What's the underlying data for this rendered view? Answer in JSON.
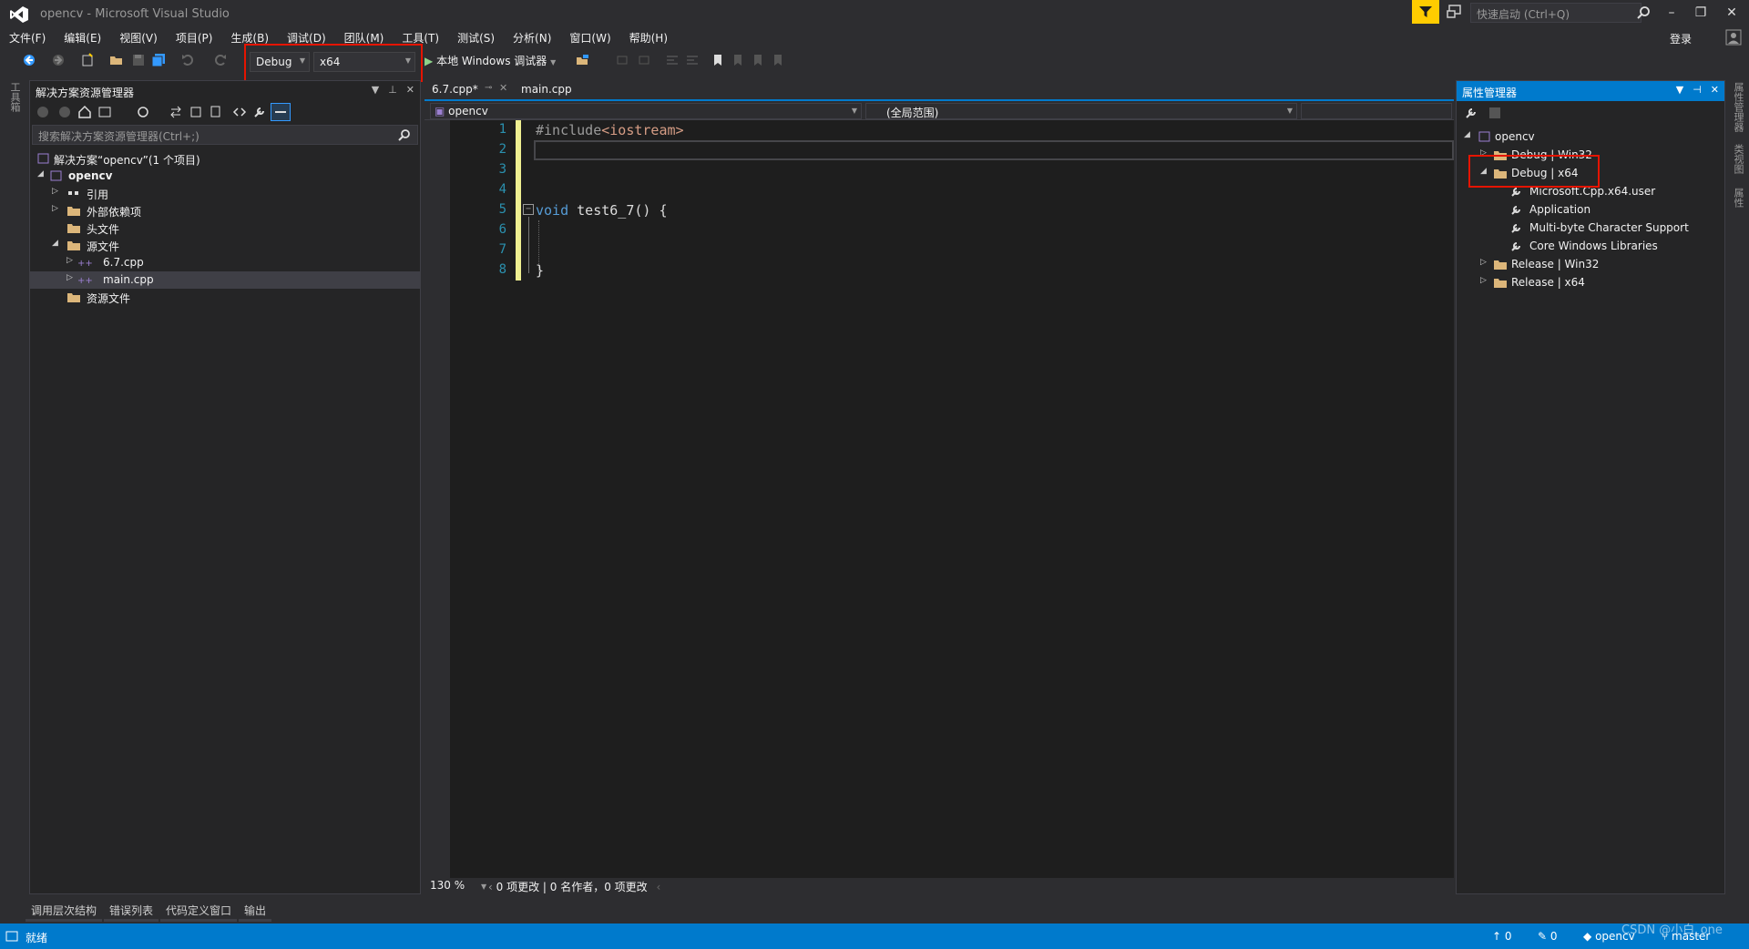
{
  "window": {
    "title": "opencv - Microsoft Visual Studio",
    "quick_launch_placeholder": "快速启动 (Ctrl+Q)",
    "login": "登录",
    "controls": [
      "–",
      "❐",
      "✕"
    ]
  },
  "menu": [
    "文件(F)",
    "编辑(E)",
    "视图(V)",
    "项目(P)",
    "生成(B)",
    "调试(D)",
    "团队(M)",
    "工具(T)",
    "测试(S)",
    "分析(N)",
    "窗口(W)",
    "帮助(H)"
  ],
  "toolbar": {
    "config": "Debug",
    "platform": "x64",
    "run_label": "本地 Windows 调试器"
  },
  "left_strip": {
    "tab": "工具箱"
  },
  "solution_explorer": {
    "title": "解决方案资源管理器",
    "search_placeholder": "搜索解决方案资源管理器(Ctrl+;)",
    "tree": [
      {
        "label": "解决方案“opencv”(1 个项目)"
      },
      {
        "label": "opencv"
      },
      {
        "label": "引用"
      },
      {
        "label": "外部依赖项"
      },
      {
        "label": "头文件"
      },
      {
        "label": "源文件"
      },
      {
        "label": "6.7.cpp"
      },
      {
        "label": "main.cpp"
      },
      {
        "label": "资源文件"
      }
    ]
  },
  "bottom_tabs": [
    "调用层次结构",
    "错误列表",
    "代码定义窗口",
    "输出"
  ],
  "editor": {
    "tabs": [
      {
        "label": "6.7.cpp*"
      },
      {
        "label": "main.cpp"
      }
    ],
    "nav_project": "opencv",
    "nav_scope": "(全局范围)",
    "line_numbers": [
      "1",
      "2",
      "3",
      "4",
      "5",
      "6",
      "7",
      "8"
    ],
    "lines": {
      "l1_kw": "#include",
      "l1_inc": "<iostream>",
      "l5_kw": "void",
      "l5_rest": " test6_7() {",
      "l8": "}"
    },
    "zoom": "130 %",
    "codelens": "0 项更改 | 0 名作者，0 项更改"
  },
  "property_manager": {
    "title": "属性管理器",
    "tree": [
      {
        "label": "opencv"
      },
      {
        "label": "Debug | Win32"
      },
      {
        "label": "Debug | x64"
      },
      {
        "label": "Microsoft.Cpp.x64.user"
      },
      {
        "label": "Application"
      },
      {
        "label": "Multi-byte Character Support"
      },
      {
        "label": "Core Windows Libraries"
      },
      {
        "label": "Release | Win32"
      },
      {
        "label": "Release | x64"
      }
    ]
  },
  "right_strip": {
    "tabs": [
      "属性管理器",
      "类视图",
      "属性"
    ]
  },
  "statusbar": {
    "ready": "就绪",
    "up_count": "0",
    "edit_count": "0",
    "repo": "opencv",
    "branch": "master",
    "watermark": "CSDN @小白_one"
  },
  "colors": {
    "accent": "#007acc",
    "highlight_box": "#e51400",
    "filter_button": "#ffcc00"
  }
}
